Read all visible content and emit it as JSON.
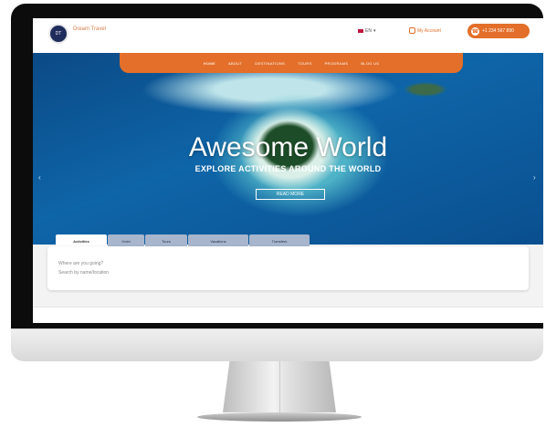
{
  "header": {
    "logo_mark": "DT",
    "logo_text": "Dream Travel",
    "language": "EN",
    "contact_label": "My Account",
    "phone": "+1 234 567 890",
    "phone_icon": "phone-icon"
  },
  "nav": {
    "items": [
      "HOME",
      "ABOUT",
      "DESTINATIONS",
      "TOURS",
      "PROGRAMS",
      "BLOG US"
    ]
  },
  "hero": {
    "title": "Awesome World",
    "subtitle": "EXPLORE ACTIVITIES AROUND THE WORLD",
    "button": "READ MORE",
    "prev": "‹",
    "next": "›"
  },
  "search": {
    "tabs": [
      "Activities",
      "Hotel",
      "Tours",
      "Vacations",
      "Transfers"
    ],
    "line1": "Where are you going?",
    "line2": "Search by name/location"
  },
  "colors": {
    "accent": "#e36f2a",
    "brand_dark": "#1f2c5c"
  }
}
